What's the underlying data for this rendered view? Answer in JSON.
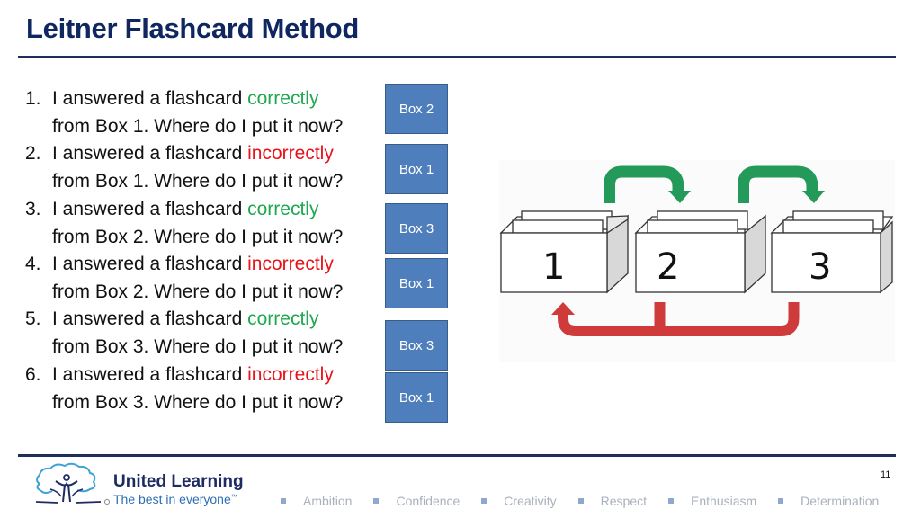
{
  "slide": {
    "title": "Leitner Flashcard Method",
    "page_number": "11"
  },
  "questions": [
    {
      "num": "1.",
      "prefix": "I answered a flashcard ",
      "result": "correctly",
      "result_type": "correct",
      "line2": "from Box 1. Where do I put it now?",
      "answer": "Box 2"
    },
    {
      "num": "2.",
      "prefix": "I answered a flashcard ",
      "result": "incorrectly",
      "result_type": "incorrect",
      "line2": "from Box 1. Where do I put it now?",
      "answer": "Box 1"
    },
    {
      "num": "3.",
      "prefix": "I answered a flashcard ",
      "result": "correctly",
      "result_type": "correct",
      "line2": "from Box 2. Where do I put it now?",
      "answer": "Box 3"
    },
    {
      "num": "4.",
      "prefix": "I answered a flashcard ",
      "result": "incorrectly",
      "result_type": "incorrect",
      "line2": "from Box 2. Where do I put it now?",
      "answer": "Box 1"
    },
    {
      "num": "5.",
      "prefix": "I answered a flashcard ",
      "result": "correctly",
      "result_type": "correct",
      "line2": "from Box 3. Where do I put it now?",
      "answer": "Box 3"
    },
    {
      "num": "6.",
      "prefix": "I answered a flashcard ",
      "result": "incorrectly",
      "result_type": "incorrect",
      "line2": "from Box 3. Where do I put it now?",
      "answer": "Box 1"
    }
  ],
  "diagram": {
    "boxes": [
      "1",
      "2",
      "3"
    ],
    "correct_arrows": [
      {
        "from": "1",
        "to": "2"
      },
      {
        "from": "2",
        "to": "3"
      }
    ],
    "incorrect_arrows": [
      {
        "from": "2",
        "to": "1"
      },
      {
        "from": "3",
        "to": "1"
      }
    ],
    "colors": {
      "correct_arrow": "#239a5a",
      "incorrect_arrow": "#cf3b3b"
    }
  },
  "colors": {
    "title": "#0f2660",
    "correct": "#1fa84f",
    "incorrect": "#e8131a",
    "answer_box": "#4f7ebc"
  },
  "footer": {
    "brand_name": "United Learning",
    "tagline": "The best in everyone",
    "trademark": "™",
    "values": [
      "Ambition",
      "Confidence",
      "Creativity",
      "Respect",
      "Enthusiasm",
      "Determination"
    ]
  }
}
